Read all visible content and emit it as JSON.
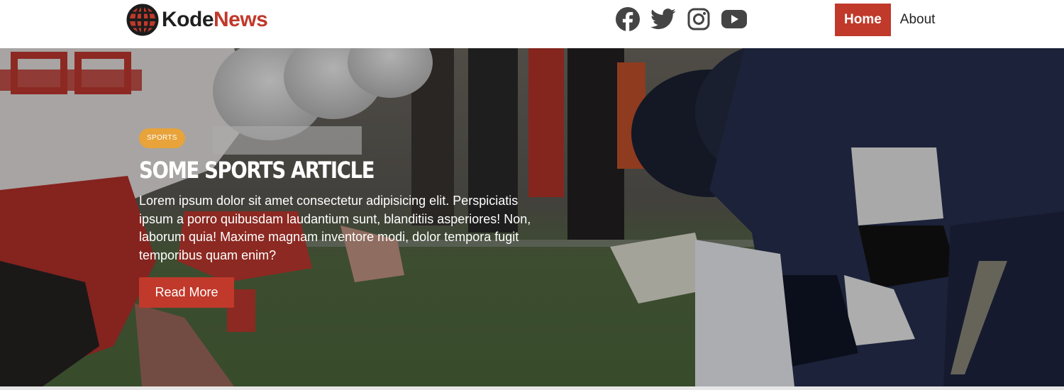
{
  "brand": {
    "name_part1": "Kode",
    "name_part2": "News",
    "accent_color": "#c0392b"
  },
  "social": [
    {
      "icon": "facebook-icon"
    },
    {
      "icon": "twitter-icon"
    },
    {
      "icon": "instagram-icon"
    },
    {
      "icon": "youtube-icon"
    }
  ],
  "nav": {
    "home_label": "Home",
    "about_label": "About"
  },
  "hero": {
    "category": "Sports",
    "title": "Some Sports Article",
    "excerpt": "Lorem ipsum dolor sit amet consectetur adipisicing elit. Perspiciatis ipsum a porro quibusdam laudantium sunt, blanditiis asperiores! Non, laborum quia! Maxime magnam inventore modi, dolor tempora fugit temporibus quam enim?",
    "cta_label": "Read More",
    "badge_color": "#e8a33a"
  }
}
